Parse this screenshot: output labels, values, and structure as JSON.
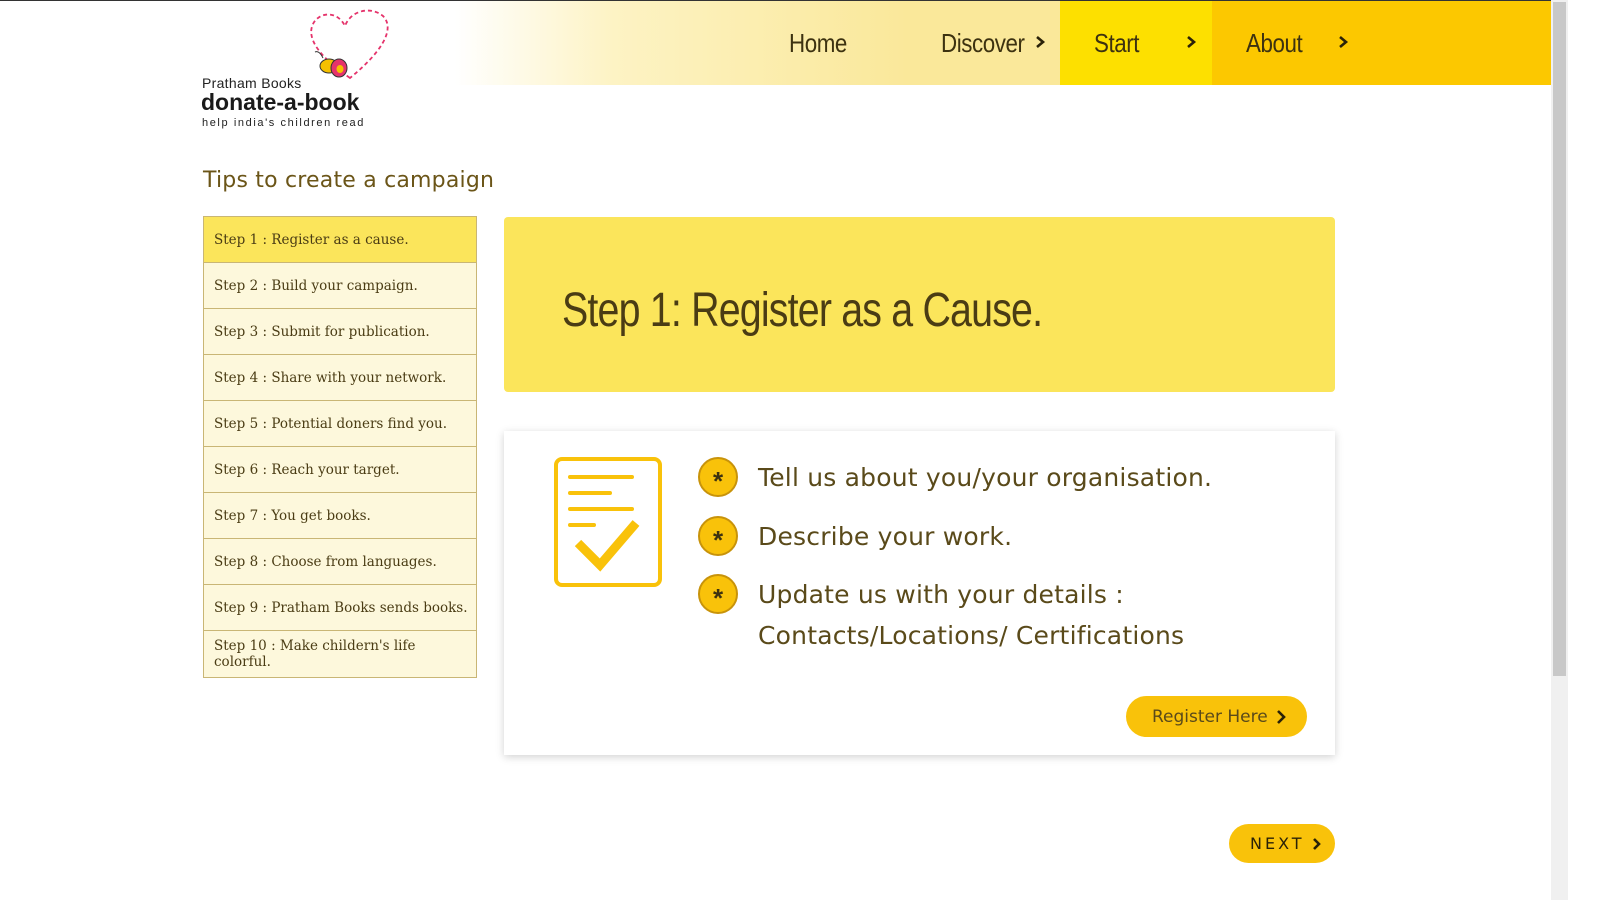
{
  "colors": {
    "accent_yellow": "#fbe55b",
    "button_yellow": "#f9c20a",
    "nav_discover": "#fae89a",
    "nav_start": "#fde000",
    "nav_about": "#fcc800",
    "text_brown": "#5a4a1a",
    "list_bg": "#fdf8dc"
  },
  "logo": {
    "line1": "Pratham Books",
    "line2": "donate-a-book",
    "line3": "help india's children read"
  },
  "nav": {
    "home": "Home",
    "discover": "Discover",
    "start": "Start",
    "about": "About"
  },
  "sidebar": {
    "title": "Tips to create a campaign",
    "steps": [
      "Step 1 : Register as a cause.",
      "Step 2 : Build your campaign.",
      "Step 3 : Submit for publication.",
      "Step 4 : Share with your network.",
      "Step 5 : Potential doners find you.",
      "Step 6 : Reach your target.",
      "Step 7 : You get books.",
      "Step 8 : Choose from languages.",
      "Step 9 : Pratham Books sends books.",
      "Step 10 : Make childern's life colorful."
    ],
    "active_index": 0
  },
  "main": {
    "heading": "Step 1: Register as a Cause.",
    "icon": "checklist-document-icon",
    "bullet_symbol": "*",
    "bullets": [
      "Tell us about you/your organisation.",
      "Describe your work.",
      "Update us with your details : Contacts/Locations/ Certifications"
    ],
    "register_label": "Register Here"
  },
  "footer": {
    "next_label": "NEXT"
  }
}
